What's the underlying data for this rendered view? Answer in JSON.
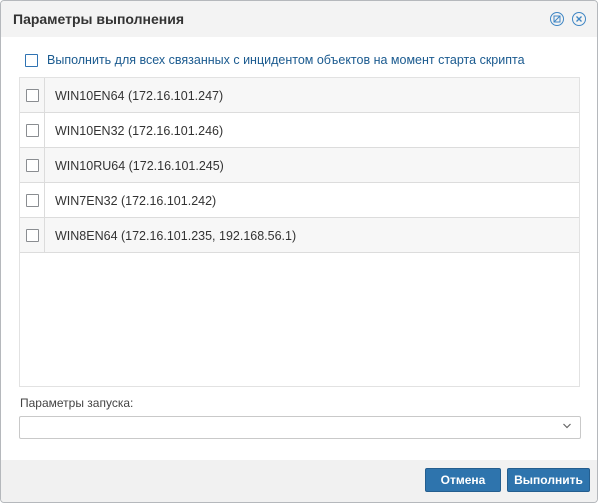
{
  "dialog": {
    "title": "Параметры выполнения",
    "header_icons": [
      "minimize-icon",
      "close-icon"
    ]
  },
  "select_all": {
    "label": "Выполнить для всех связанных с инцидентом объектов на момент старта скрипта",
    "checked": false
  },
  "hosts": [
    {
      "label": "WIN10EN64 (172.16.101.247)",
      "checked": false
    },
    {
      "label": "WIN10EN32 (172.16.101.246)",
      "checked": false
    },
    {
      "label": "WIN10RU64 (172.16.101.245)",
      "checked": false
    },
    {
      "label": "WIN7EN32 (172.16.101.242)",
      "checked": false
    },
    {
      "label": "WIN8EN64 (172.16.101.235, 192.168.56.1)",
      "checked": false
    }
  ],
  "launch_params": {
    "label": "Параметры запуска:",
    "value": ""
  },
  "buttons": {
    "cancel": "Отмена",
    "run": "Выполнить"
  },
  "colors": {
    "accent": "#2e74ad",
    "link_text": "#1a5a8f"
  }
}
